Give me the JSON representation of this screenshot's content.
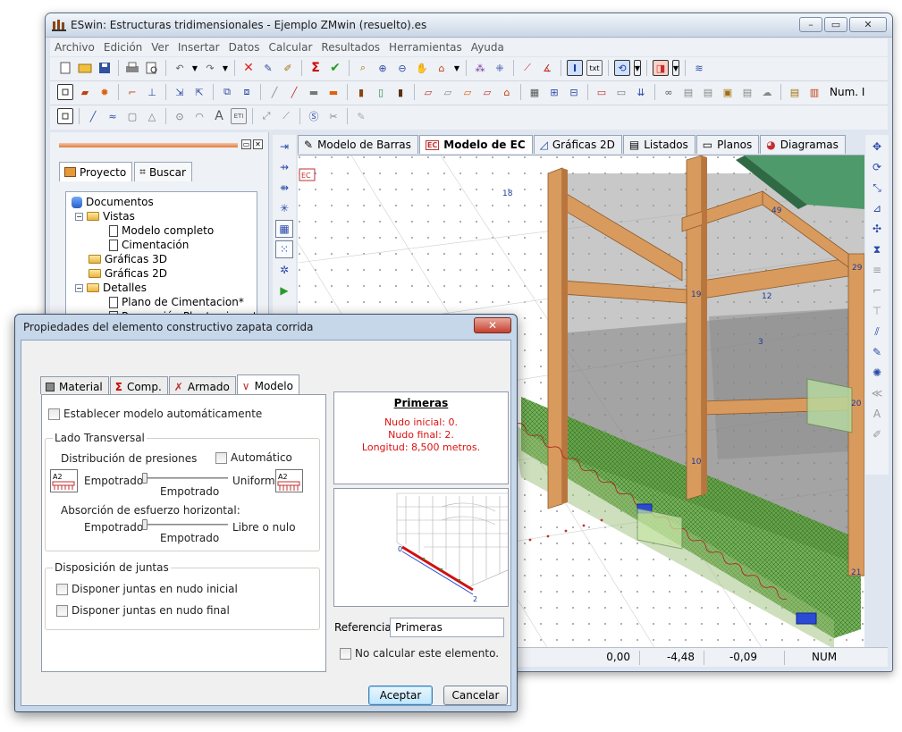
{
  "main_window": {
    "title": "ESwin: Estructuras tridimensionales - Ejemplo ZMwin (resuelto).es",
    "menu": [
      "Archivo",
      "Edición",
      "Ver",
      "Insertar",
      "Datos",
      "Calcular",
      "Resultados",
      "Herramientas",
      "Ayuda"
    ],
    "toolbar_num_label": "Num. I",
    "project_pane": {
      "tabs": [
        "Proyecto",
        "Buscar"
      ],
      "tree": [
        {
          "label": "Documentos",
          "type": "db"
        },
        {
          "label": "Vistas",
          "type": "folder"
        },
        {
          "label": "Modelo completo",
          "type": "doc"
        },
        {
          "label": "Cimentación",
          "type": "doc"
        },
        {
          "label": "Gráficas 3D",
          "type": "folder"
        },
        {
          "label": "Gráficas 2D",
          "type": "folder"
        },
        {
          "label": "Detalles",
          "type": "folder"
        },
        {
          "label": "Plano de Cimentacion*",
          "type": "doc"
        },
        {
          "label": "Proyección Planta cimentación",
          "type": "doc"
        }
      ]
    },
    "doc_tabs": [
      "Modelo de Barras",
      "Modelo de EC",
      "Gráficas 2D",
      "Listados",
      "Planos",
      "Diagramas"
    ],
    "active_doc_tab": "Modelo de EC",
    "viewport_badge": "EC",
    "node_labels": [
      "18",
      "49",
      "29",
      "19",
      "12",
      "3",
      "20",
      "10",
      "21"
    ],
    "status": {
      "x": "0,00",
      "y": "-4,48",
      "z": "-0,09",
      "mode": "NUM"
    }
  },
  "dialog": {
    "title": "Propiedades del elemento constructivo zapata corrida",
    "close_label": "✕",
    "tabs": [
      "Material",
      "Comp.",
      "Armado",
      "Modelo"
    ],
    "active_tab": "Modelo",
    "auto_model_label": "Establecer modelo automáticamente",
    "lado_transversal": {
      "title": "Lado Transversal",
      "distribucion_label": "Distribución de presiones",
      "automatico_label": "Automático",
      "empotrado_left": "Empotrado",
      "empotrado_below": "Empotrado",
      "uniforme_label": "Uniforme",
      "absorcion_label": "Absorción de esfuerzo horizontal:",
      "empotrado2_left": "Empotrado",
      "empotrado2_below": "Empotrado",
      "libre_label": "Libre o nulo",
      "picto_text": "A2"
    },
    "juntas": {
      "title": "Disposición de juntas",
      "inicial_label": "Disponer juntas en nudo inicial",
      "final_label": "Disponer juntas en nudo final"
    },
    "info": {
      "title": "Primeras",
      "nudo_inicial": "Nudo inicial: 0.",
      "nudo_final": "Nudo final: 2.",
      "longitud": "Longitud: 8,500 metros."
    },
    "preview_nodes": [
      "0",
      "2"
    ],
    "referencia_label": "Referencia:",
    "referencia_value": "Primeras",
    "no_calcular_label": "No calcular este elemento.",
    "accept_label": "Aceptar",
    "cancel_label": "Cancelar"
  },
  "colors": {
    "wood": "#d99a5e",
    "roof": "#4f9a6a",
    "footing_green": "#5aa13a",
    "accent_red": "#cc1111"
  }
}
